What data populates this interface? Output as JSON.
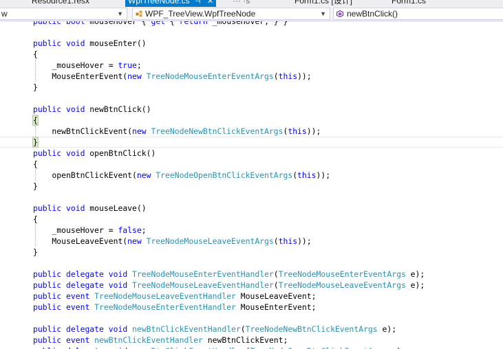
{
  "tabs": [
    {
      "label": "Resource1.resx"
    },
    {
      "label": "WpfTreeNode.cs",
      "active": true
    },
    {
      "label": "··· ·s"
    },
    {
      "label": "Form1.cs [设计]"
    },
    {
      "label": "Form1.cs"
    }
  ],
  "navbar": {
    "project": "w",
    "type": "WPF_TreeView.WpfTreeNode",
    "member": "newBtnClick()"
  },
  "icons": {
    "class_icon": "class-icon",
    "method_icon": "method-icon",
    "close_icon": "close-icon",
    "pin_icon": "pin-icon",
    "dropdown_icon": "chevron-down-icon"
  },
  "colors": {
    "keyword": "#0000ff",
    "type": "#2b91af",
    "text": "#000000",
    "active_tab": "#007acc"
  },
  "code_lines": [
    [
      {
        "t": "public",
        "k": "kw"
      },
      {
        "t": " "
      },
      {
        "t": "bool",
        "k": "kw"
      },
      {
        "t": " mouseHover { "
      },
      {
        "t": "get",
        "k": "kw"
      },
      {
        "t": " { "
      },
      {
        "t": "return",
        "k": "kw"
      },
      {
        "t": " _mouseHover; } }"
      }
    ],
    [],
    [
      {
        "t": "public",
        "k": "kw"
      },
      {
        "t": " "
      },
      {
        "t": "void",
        "k": "kw"
      },
      {
        "t": " mouseEnter()"
      }
    ],
    [
      {
        "t": "{"
      }
    ],
    [
      {
        "t": "    _mouseHover = "
      },
      {
        "t": "true",
        "k": "kw"
      },
      {
        "t": ";"
      }
    ],
    [
      {
        "t": "    MouseEnterEvent("
      },
      {
        "t": "new",
        "k": "kw"
      },
      {
        "t": " "
      },
      {
        "t": "TreeNodeMouseEnterEventArgs",
        "k": "ty"
      },
      {
        "t": "("
      },
      {
        "t": "this",
        "k": "kw"
      },
      {
        "t": "));"
      }
    ],
    [
      {
        "t": "}"
      }
    ],
    [],
    [
      {
        "t": "public",
        "k": "kw"
      },
      {
        "t": " "
      },
      {
        "t": "void",
        "k": "kw"
      },
      {
        "t": " newBtnClick()"
      }
    ],
    [
      {
        "t": "{",
        "k": "hl"
      }
    ],
    [
      {
        "t": "    newBtnClickEvent("
      },
      {
        "t": "new",
        "k": "kw"
      },
      {
        "t": " "
      },
      {
        "t": "TreeNodeNewBtnClickEventArgs",
        "k": "ty"
      },
      {
        "t": "("
      },
      {
        "t": "this",
        "k": "kw"
      },
      {
        "t": "));"
      }
    ],
    [
      {
        "t": "}",
        "k": "hl"
      }
    ],
    [
      {
        "t": "public",
        "k": "kw"
      },
      {
        "t": " "
      },
      {
        "t": "void",
        "k": "kw"
      },
      {
        "t": " openBtnClick()"
      }
    ],
    [
      {
        "t": "{"
      }
    ],
    [
      {
        "t": "    openBtnClickEvent("
      },
      {
        "t": "new",
        "k": "kw"
      },
      {
        "t": " "
      },
      {
        "t": "TreeNodeOpenBtnClickEventArgs",
        "k": "ty"
      },
      {
        "t": "("
      },
      {
        "t": "this",
        "k": "kw"
      },
      {
        "t": "));"
      }
    ],
    [
      {
        "t": "}"
      }
    ],
    [],
    [
      {
        "t": "public",
        "k": "kw"
      },
      {
        "t": " "
      },
      {
        "t": "void",
        "k": "kw"
      },
      {
        "t": " mouseLeave()"
      }
    ],
    [
      {
        "t": "{"
      }
    ],
    [
      {
        "t": "    _mouseHover = "
      },
      {
        "t": "false",
        "k": "kw"
      },
      {
        "t": ";"
      }
    ],
    [
      {
        "t": "    MouseLeaveEvent("
      },
      {
        "t": "new",
        "k": "kw"
      },
      {
        "t": " "
      },
      {
        "t": "TreeNodeMouseLeaveEventArgs",
        "k": "ty"
      },
      {
        "t": "("
      },
      {
        "t": "this",
        "k": "kw"
      },
      {
        "t": "));"
      }
    ],
    [
      {
        "t": "}"
      }
    ],
    [],
    [
      {
        "t": "public",
        "k": "kw"
      },
      {
        "t": " "
      },
      {
        "t": "delegate",
        "k": "kw"
      },
      {
        "t": " "
      },
      {
        "t": "void",
        "k": "kw"
      },
      {
        "t": " "
      },
      {
        "t": "TreeNodeMouseEnterEventHandler",
        "k": "ty"
      },
      {
        "t": "("
      },
      {
        "t": "TreeNodeMouseEnterEventArgs",
        "k": "ty"
      },
      {
        "t": " e);"
      }
    ],
    [
      {
        "t": "public",
        "k": "kw"
      },
      {
        "t": " "
      },
      {
        "t": "delegate",
        "k": "kw"
      },
      {
        "t": " "
      },
      {
        "t": "void",
        "k": "kw"
      },
      {
        "t": " "
      },
      {
        "t": "TreeNodeMouseLeaveEventHandler",
        "k": "ty"
      },
      {
        "t": "("
      },
      {
        "t": "TreeNodeMouseLeaveEventArgs",
        "k": "ty"
      },
      {
        "t": " e);"
      }
    ],
    [
      {
        "t": "public",
        "k": "kw"
      },
      {
        "t": " "
      },
      {
        "t": "event",
        "k": "kw"
      },
      {
        "t": " "
      },
      {
        "t": "TreeNodeMouseLeaveEventHandler",
        "k": "ty"
      },
      {
        "t": " MouseLeaveEvent;"
      }
    ],
    [
      {
        "t": "public",
        "k": "kw"
      },
      {
        "t": " "
      },
      {
        "t": "event",
        "k": "kw"
      },
      {
        "t": " "
      },
      {
        "t": "TreeNodeMouseEnterEventHandler",
        "k": "ty"
      },
      {
        "t": " MouseEnterEvent;"
      }
    ],
    [],
    [
      {
        "t": "public",
        "k": "kw"
      },
      {
        "t": " "
      },
      {
        "t": "delegate",
        "k": "kw"
      },
      {
        "t": " "
      },
      {
        "t": "void",
        "k": "kw"
      },
      {
        "t": " "
      },
      {
        "t": "newBtnClickEventHandler",
        "k": "ty"
      },
      {
        "t": "("
      },
      {
        "t": "TreeNodeNewBtnClickEventArgs",
        "k": "ty"
      },
      {
        "t": " e);"
      }
    ],
    [
      {
        "t": "public",
        "k": "kw"
      },
      {
        "t": " "
      },
      {
        "t": "event",
        "k": "kw"
      },
      {
        "t": " "
      },
      {
        "t": "newBtnClickEventHandler",
        "k": "ty"
      },
      {
        "t": " newBtnClickEvent;"
      }
    ],
    [
      {
        "t": "public",
        "k": "kw"
      },
      {
        "t": " "
      },
      {
        "t": "delegate",
        "k": "kw"
      },
      {
        "t": " "
      },
      {
        "t": "void",
        "k": "kw"
      },
      {
        "t": " "
      },
      {
        "t": "openBtnClickEventHandler",
        "k": "ty"
      },
      {
        "t": "("
      },
      {
        "t": "TreeNodeOpenBtnClickEventArgs",
        "k": "ty"
      },
      {
        "t": " e);"
      }
    ]
  ]
}
